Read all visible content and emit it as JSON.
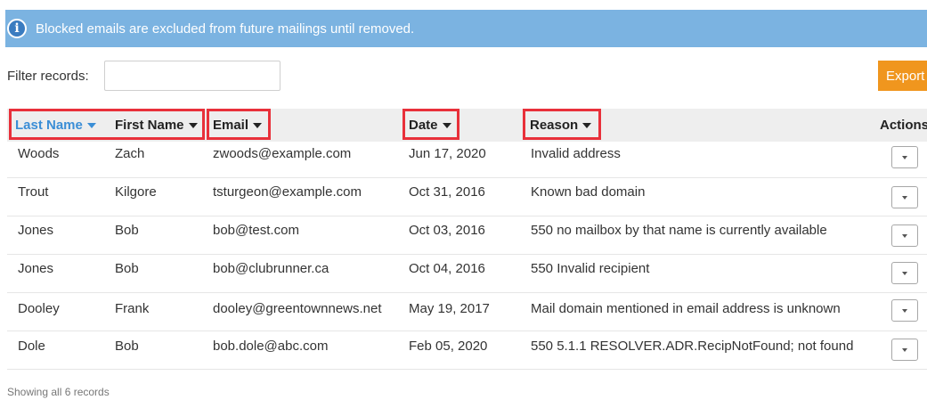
{
  "banner": {
    "icon": "info-icon",
    "icon_glyph": "i",
    "text": "Blocked emails are excluded from future mailings until removed."
  },
  "filter": {
    "label": "Filter records:",
    "value": "",
    "placeholder": ""
  },
  "export": {
    "label": "Export"
  },
  "table": {
    "headers": {
      "last_name": "Last Name",
      "first_name": "First Name",
      "email": "Email",
      "date": "Date",
      "reason": "Reason",
      "actions": "Actions"
    },
    "rows": [
      {
        "last_name": "Woods",
        "first_name": "Zach",
        "email": "zwoods@example.com",
        "date": "Jun 17, 2020",
        "reason": "Invalid address"
      },
      {
        "last_name": "Trout",
        "first_name": "Kilgore",
        "email": "tsturgeon@example.com",
        "date": "Oct 31, 2016",
        "reason": "Known bad domain"
      },
      {
        "last_name": "Jones",
        "first_name": "Bob",
        "email": "bob@test.com",
        "date": "Oct 03, 2016",
        "reason": "550 no mailbox by that name is currently available"
      },
      {
        "last_name": "Jones",
        "first_name": "Bob",
        "email": "bob@clubrunner.ca",
        "date": "Oct 04, 2016",
        "reason": "550 Invalid recipient"
      },
      {
        "last_name": "Dooley",
        "first_name": "Frank",
        "email": "dooley@greentownnews.net",
        "date": "May 19, 2017",
        "reason": "Mail domain mentioned in email address is unknown"
      },
      {
        "last_name": "Dole",
        "first_name": "Bob",
        "email": "bob.dole@abc.com",
        "date": "Feb 05, 2020",
        "reason": "550 5.1.1 RESOLVER.ADR.RecipNotFound; not found"
      }
    ]
  },
  "footer": {
    "text": "Showing all 6 records"
  },
  "colors": {
    "banner": "#7bb3e1",
    "export": "#f0961e",
    "active_sort": "#3b8ed6",
    "highlight": "#e8303a"
  }
}
